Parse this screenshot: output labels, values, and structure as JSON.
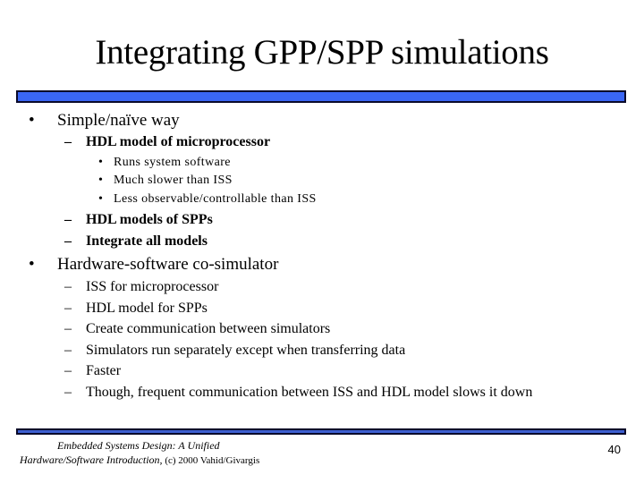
{
  "slide": {
    "title": "Integrating GPP/SPP simulations",
    "accent_color": "#3a66f5",
    "bullets": [
      {
        "text": "Simple/naïve way",
        "children": [
          {
            "text": "HDL model of microprocessor",
            "children": [
              {
                "text": "Runs system software"
              },
              {
                "text": "Much slower than ISS"
              },
              {
                "text": "Less observable/controllable than ISS"
              }
            ]
          },
          {
            "text": "HDL models of SPPs"
          },
          {
            "text": "Integrate all models"
          }
        ]
      },
      {
        "text": "Hardware-software co-simulator",
        "children": [
          {
            "text": "ISS for microprocessor"
          },
          {
            "text": "HDL model for SPPs"
          },
          {
            "text": "Create communication between simulators"
          },
          {
            "text": "Simulators run separately except when transferring data"
          },
          {
            "text": "Faster"
          },
          {
            "text": "Though, frequent communication between ISS and HDL model slows it down"
          }
        ]
      }
    ],
    "bullet_glyph": "•",
    "dash_glyph": "–"
  },
  "footer": {
    "line1": "Embedded Systems Design: A Unified",
    "line2_italic": "Hardware/Software Introduction,",
    "line2_plain": " (c) 2000 Vahid/Givargis",
    "page_number": "40"
  }
}
